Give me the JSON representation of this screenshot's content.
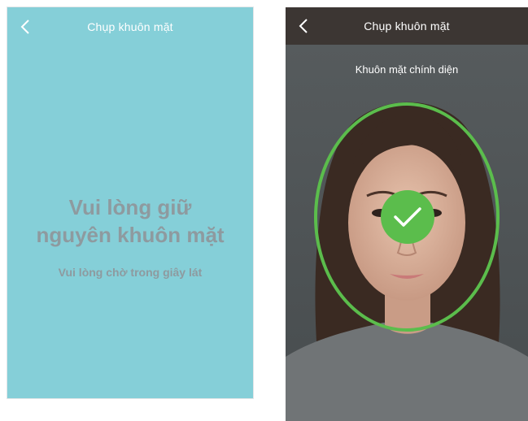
{
  "left_screen": {
    "header": {
      "title": "Chụp khuôn mặt"
    },
    "message": {
      "line1": "Vui lòng giữ",
      "line2": "nguyên khuôn mặt"
    },
    "submessage": "Vui lòng chờ trong giây lát"
  },
  "right_screen": {
    "header": {
      "title": "Chụp khuôn mặt"
    },
    "instruction": "Khuôn mặt chính diện",
    "status": "success"
  },
  "colors": {
    "left_bg": "#85cfd8",
    "muted_text": "#8e9a9f",
    "right_header": "#3c3633",
    "camera_bg": "#4f5557",
    "success_green": "#5bbd4c"
  },
  "icons": {
    "back": "chevron-left-icon",
    "success": "checkmark-icon"
  }
}
